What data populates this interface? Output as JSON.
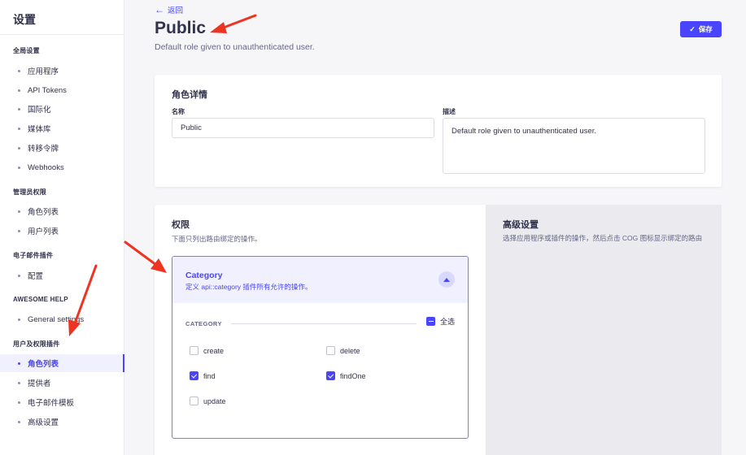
{
  "sidebar": {
    "title": "设置",
    "sections": [
      {
        "heading": "全局设置",
        "items": [
          "应用程序",
          "API Tokens",
          "国际化",
          "媒体库",
          "转移令牌",
          "Webhooks"
        ]
      },
      {
        "heading": "管理员权限",
        "items": [
          "角色列表",
          "用户列表"
        ]
      },
      {
        "heading": "电子邮件插件",
        "items": [
          "配置"
        ]
      },
      {
        "heading": "AWESOME HELP",
        "items": [
          "General settings"
        ]
      },
      {
        "heading": "用户及权限插件",
        "items": [
          "角色列表",
          "提供者",
          "电子邮件模板",
          "高级设置"
        ]
      }
    ],
    "active_item": "角色列表"
  },
  "header": {
    "back_label": "返回",
    "title": "Public",
    "subtitle": "Default role given to unauthenticated user.",
    "save_label": "保存"
  },
  "details": {
    "heading": "角色详情",
    "name_label": "名称",
    "name_value": "Public",
    "description_label": "描述",
    "description_value": "Default role given to unauthenticated user."
  },
  "permissions": {
    "heading": "权限",
    "description": "下面只列出路由绑定的操作。",
    "accordion": {
      "title": "Category",
      "subtitle": "定义 api::category 插件所有允许的操作。",
      "category_label": "CATEGORY",
      "select_all_label": "全选",
      "actions": [
        {
          "label": "create",
          "checked": false
        },
        {
          "label": "delete",
          "checked": false
        },
        {
          "label": "find",
          "checked": true
        },
        {
          "label": "findOne",
          "checked": true
        },
        {
          "label": "update",
          "checked": false
        }
      ]
    }
  },
  "advanced": {
    "title": "高级设置",
    "description": "选择应用程序或插件的操作，然后点击 COG 图标显示绑定的路由"
  },
  "colors": {
    "primary": "#4945ff",
    "annotation_arrow": "#ee3322"
  }
}
